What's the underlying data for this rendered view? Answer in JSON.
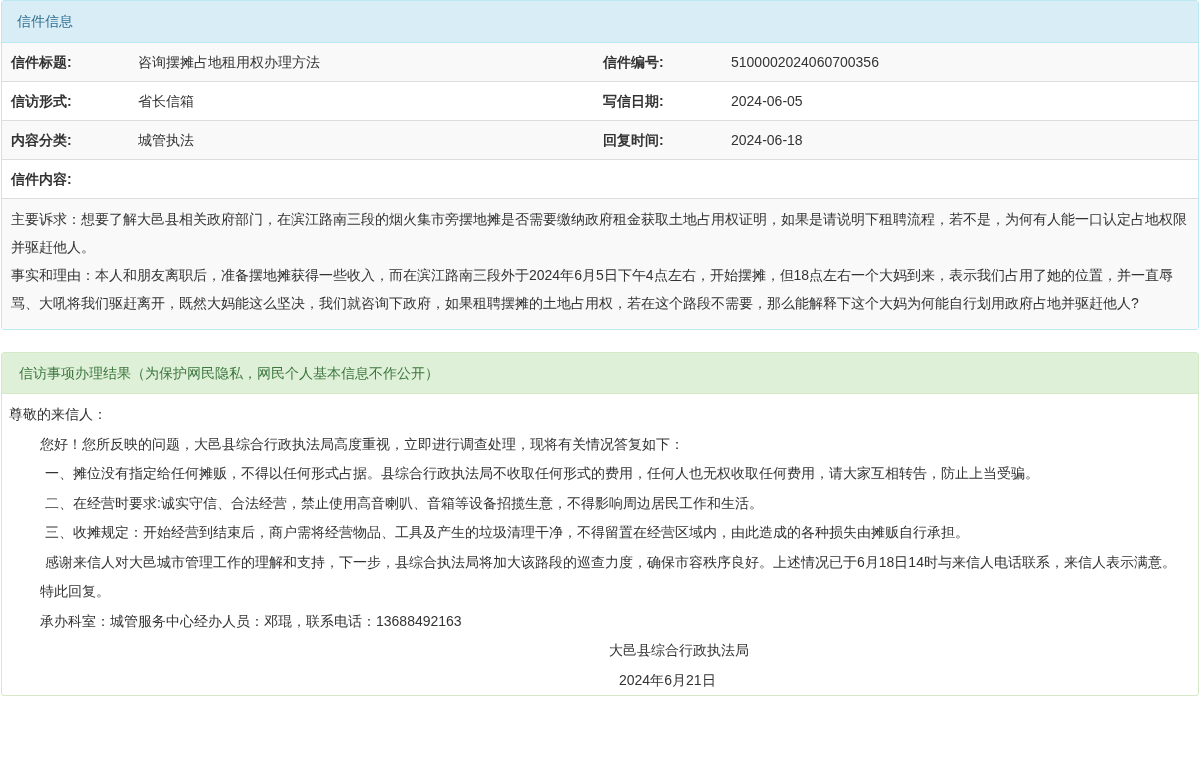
{
  "letter_panel": {
    "title": "信件信息",
    "rows": [
      [
        {
          "label": "信件标题:",
          "value": "咨询摆摊占地租用权办理方法"
        },
        {
          "label": "信件编号:",
          "value": "5100002024060700356"
        }
      ],
      [
        {
          "label": "信访形式:",
          "value": "省长信箱"
        },
        {
          "label": "写信日期:",
          "value": "2024-06-05"
        }
      ],
      [
        {
          "label": "内容分类:",
          "value": "城管执法"
        },
        {
          "label": "回复时间:",
          "value": "2024-06-18"
        }
      ]
    ],
    "content_label": "信件内容:",
    "content": [
      "主要诉求：想要了解大邑县相关政府部门，在滨江路南三段的烟火集市旁摆地摊是否需要缴纳政府租金获取土地占用权证明，如果是请说明下租聘流程，若不是，为何有人能一口认定占地权限并驱赶他人。",
      "事实和理由：本人和朋友离职后，准备摆地摊获得一些收入，而在滨江路南三段外于2024年6月5日下午4点左右，开始摆摊，但18点左右一个大妈到来，表示我们占用了她的位置，并一直辱骂、大吼将我们驱赶离开，既然大妈能这么坚决，我们就咨询下政府，如果租聘摆摊的土地占用权，若在这个路段不需要，那么能解释下这个大妈为何能自行划用政府占地并驱赶他人?"
    ]
  },
  "reply_panel": {
    "title": "信访事项办理结果（为保护网民隐私，网民个人基本信息不作公开）",
    "paragraphs": [
      {
        "kind": "plain",
        "text": "尊敬的来信人："
      },
      {
        "kind": "indent",
        "text": "您好！您所反映的问题，大邑县综合行政执法局高度重视，立即进行调查处理，现将有关情况答复如下："
      },
      {
        "kind": "item",
        "text": "一、摊位没有指定给任何摊贩，不得以任何形式占据。县综合行政执法局不收取任何形式的费用，任何人也无权收取任何费用，请大家互相转告，防止上当受骗。"
      },
      {
        "kind": "item",
        "text": "二、在经营时要求:诚实守信、合法经营，禁止使用高音喇叭、音箱等设备招揽生意，不得影响周边居民工作和生活。"
      },
      {
        "kind": "item",
        "text": "三、收摊规定：开始经营到结束后，商户需将经营物品、工具及产生的垃圾清理干净，不得留置在经营区域内，由此造成的各种损失由摊贩自行承担。"
      },
      {
        "kind": "item",
        "text": "感谢来信人对大邑城市管理工作的理解和支持，下一步，县综合执法局将加大该路段的巡查力度，确保市容秩序良好。上述情况已于6月18日14时与来信人电话联系，来信人表示满意。"
      },
      {
        "kind": "indent",
        "text": "特此回复。"
      },
      {
        "kind": "indent",
        "text": "承办科室：城管服务中心经办人员：邓琨，联系电话：13688492163"
      },
      {
        "kind": "org",
        "text": "大邑县综合行政执法局"
      },
      {
        "kind": "date",
        "text": "2024年6月21日"
      }
    ]
  }
}
